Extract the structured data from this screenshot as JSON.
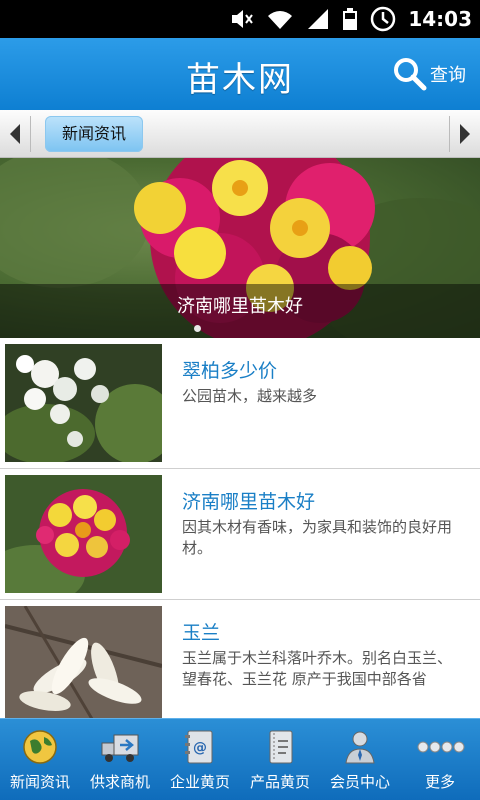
{
  "status_bar": {
    "time": "14:03"
  },
  "header": {
    "title": "苗木网",
    "search_label": "查询"
  },
  "category_bar": {
    "active_tab": "新闻资讯"
  },
  "banner": {
    "caption": "济南哪里苗木好"
  },
  "list": [
    {
      "title": "翠柏多少价",
      "desc": "公园苗木，越来越多"
    },
    {
      "title": "济南哪里苗木好",
      "desc": "因其木材有香味，为家具和装饰的良好用材。"
    },
    {
      "title": "玉兰",
      "desc": "玉兰属于木兰科落叶乔木。别名白玉兰、望春花、玉兰花 原产于我国中部各省"
    }
  ],
  "bottom_nav": [
    {
      "label": "新闻资讯",
      "icon": "globe-icon"
    },
    {
      "label": "供求商机",
      "icon": "truck-icon"
    },
    {
      "label": "企业黄页",
      "icon": "address-book-icon"
    },
    {
      "label": "产品黄页",
      "icon": "notebook-icon"
    },
    {
      "label": "会员中心",
      "icon": "user-icon"
    },
    {
      "label": "更多",
      "icon": "more-dots-icon"
    }
  ]
}
